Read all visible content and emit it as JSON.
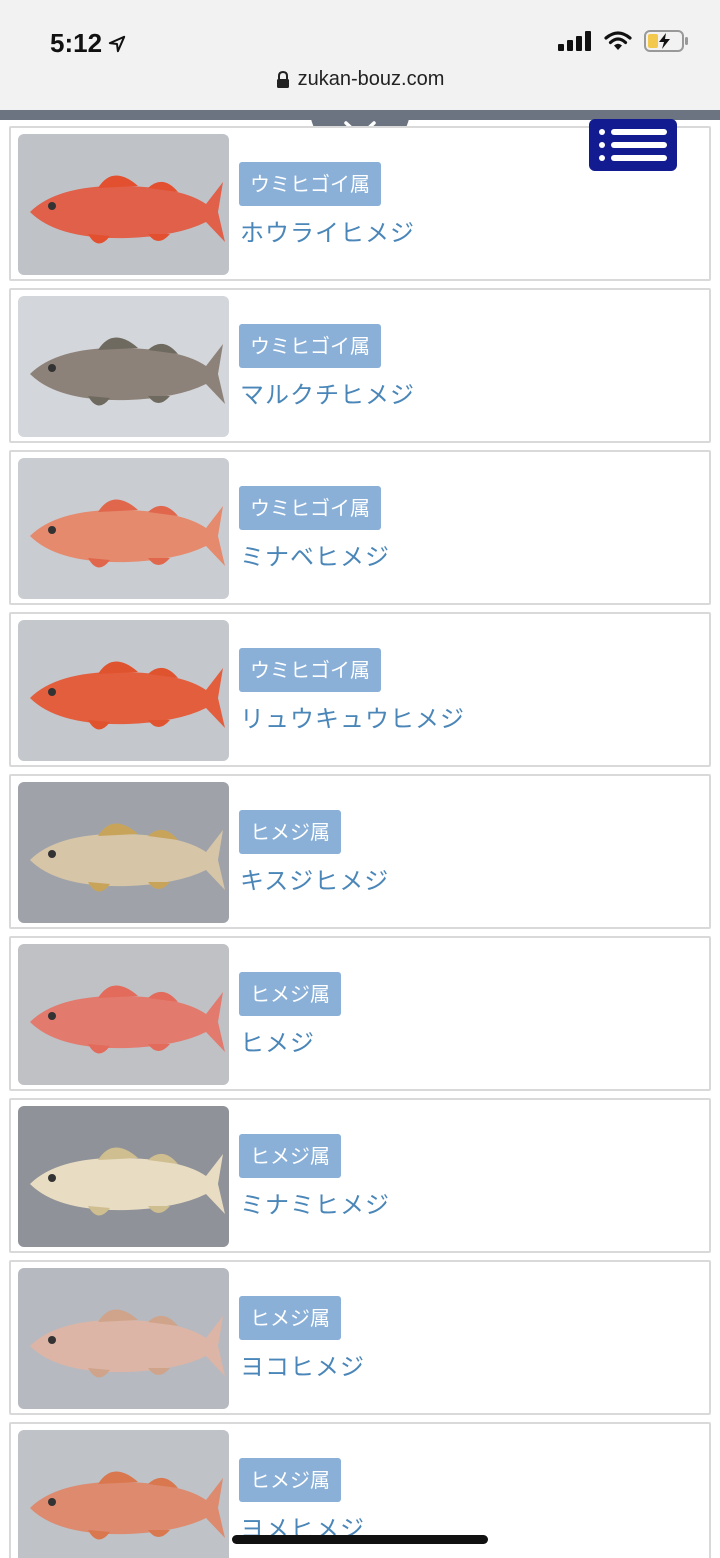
{
  "status_bar": {
    "time": "5:12"
  },
  "browser": {
    "url": "zukan-bouz.com"
  },
  "fish": [
    {
      "genus": "ウミヒゴイ属",
      "name": "ホウライヒメジ",
      "bg": "#bfc3c8",
      "body": "#e0604a",
      "fin": "#e3502f"
    },
    {
      "genus": "ウミヒゴイ属",
      "name": "マルクチヒメジ",
      "bg": "#d3d6da",
      "body": "#8d8279",
      "fin": "#6f6a60"
    },
    {
      "genus": "ウミヒゴイ属",
      "name": "ミナベヒメジ",
      "bg": "#c9cdd2",
      "body": "#e58a6d",
      "fin": "#e0664c"
    },
    {
      "genus": "ウミヒゴイ属",
      "name": "リュウキュウヒメジ",
      "bg": "#c4c7cc",
      "body": "#e35e3d",
      "fin": "#e0532f"
    },
    {
      "genus": "ヒメジ属",
      "name": "キスジヒメジ",
      "bg": "#9fa3a9",
      "body": "#d7c5a8",
      "fin": "#c8a45b"
    },
    {
      "genus": "ヒメジ属",
      "name": "ヒメジ",
      "bg": "#bfc1c5",
      "body": "#e27a6e",
      "fin": "#e26b5b"
    },
    {
      "genus": "ヒメジ属",
      "name": "ミナミヒメジ",
      "bg": "#8f9298",
      "body": "#e8dcc2",
      "fin": "#cfbe8f"
    },
    {
      "genus": "ヒメジ属",
      "name": "ヨコヒメジ",
      "bg": "#b6b9bf",
      "body": "#ddb5a6",
      "fin": "#cfa48a"
    },
    {
      "genus": "ヒメジ属",
      "name": "ヨメヒメジ",
      "bg": "#bfc2c6",
      "body": "#dd8a6e",
      "fin": "#d9774f"
    }
  ]
}
